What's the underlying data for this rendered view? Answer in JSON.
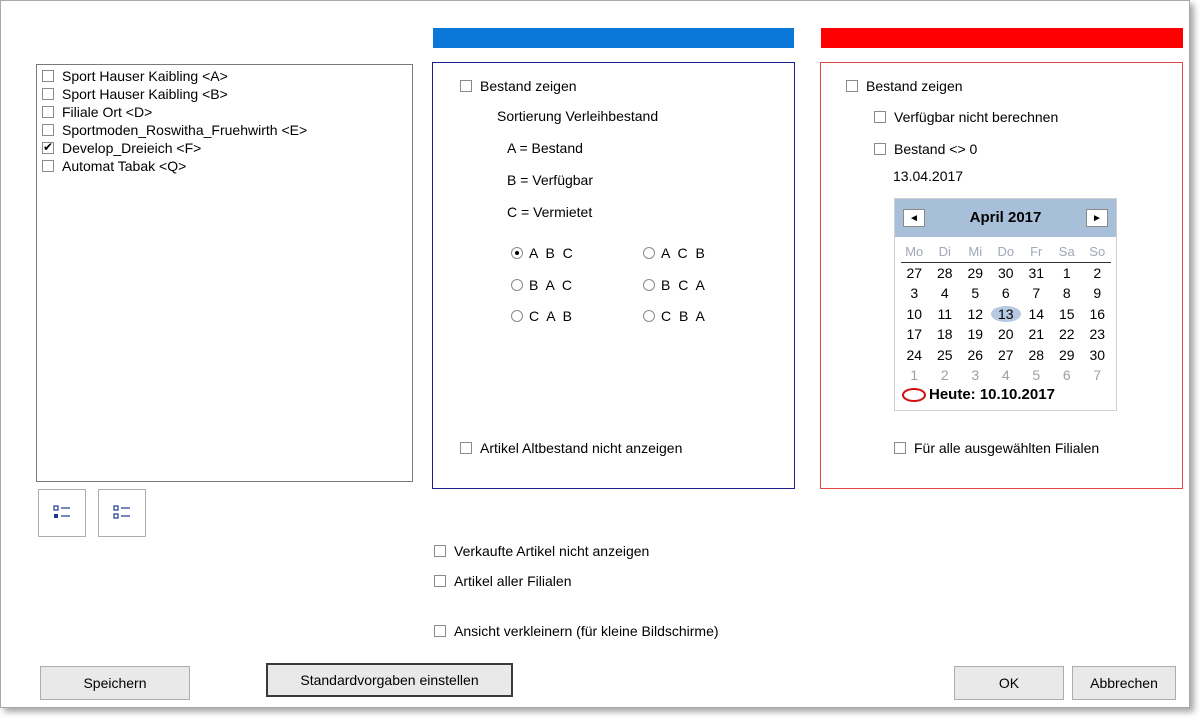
{
  "colors": {
    "blue_bar": "#0a78d8",
    "red_bar": "#ff0000",
    "blue_border": "#1e1e8c",
    "red_border": "#e04848"
  },
  "branches": [
    {
      "label": "Sport Hauser Kaibling <A>",
      "checked": false
    },
    {
      "label": "Sport Hauser Kaibling <B>",
      "checked": false
    },
    {
      "label": "Filiale Ort <D>",
      "checked": false
    },
    {
      "label": "Sportmoden_Roswitha_Fruehwirth <E>",
      "checked": false
    },
    {
      "label": "Develop_Dreieich <F>",
      "checked": true
    },
    {
      "label": "Automat Tabak <Q>",
      "checked": false
    }
  ],
  "list_buttons": {
    "select_all_icon": "list-select-icon",
    "deselect_all_icon": "list-deselect-icon"
  },
  "blue_panel": {
    "show_stock": "Bestand zeigen",
    "sort_title": "Sortierung Verleihbestand",
    "legend": [
      "A =  Bestand",
      "B =  Verfügbar",
      "C =  Vermietet"
    ],
    "radios": [
      {
        "label": "A B C",
        "selected": true
      },
      {
        "label": "A C B",
        "selected": false
      },
      {
        "label": "B A C",
        "selected": false
      },
      {
        "label": "B C A",
        "selected": false
      },
      {
        "label": "C A B",
        "selected": false
      },
      {
        "label": "C B A",
        "selected": false
      }
    ],
    "hide_old_stock": "Artikel Altbestand nicht anzeigen"
  },
  "red_panel": {
    "show_stock": "Bestand zeigen",
    "no_calc_available": "Verfügbar nicht berechnen",
    "stock_nonzero": "Bestand <> 0",
    "date": "13.04.2017",
    "calendar": {
      "month_label": "April 2017",
      "prev": "◄",
      "next": "►",
      "weekdays": [
        "Mo",
        "Di",
        "Mi",
        "Do",
        "Fr",
        "Sa",
        "So"
      ],
      "weeks": [
        [
          "27",
          "28",
          "29",
          "30",
          "31",
          "1",
          "2"
        ],
        [
          "3",
          "4",
          "5",
          "6",
          "7",
          "8",
          "9"
        ],
        [
          "10",
          "11",
          "12",
          "13",
          "14",
          "15",
          "16"
        ],
        [
          "17",
          "18",
          "19",
          "20",
          "21",
          "22",
          "23"
        ],
        [
          "24",
          "25",
          "26",
          "27",
          "28",
          "29",
          "30"
        ],
        [
          "1",
          "2",
          "3",
          "4",
          "5",
          "6",
          "7"
        ]
      ],
      "today_label": "Heute: 10.10.2017"
    },
    "all_branches": "Für alle ausgewählten Filialen"
  },
  "options": {
    "hide_sold": "Verkaufte Artikel nicht anzeigen",
    "all_branches_articles": "Artikel aller Filialen",
    "compact_view": "Ansicht verkleinern (für kleine Bildschirme)"
  },
  "buttons": {
    "save": "Speichern",
    "defaults": "Standardvorgaben einstellen",
    "ok": "OK",
    "cancel": "Abbrechen"
  }
}
